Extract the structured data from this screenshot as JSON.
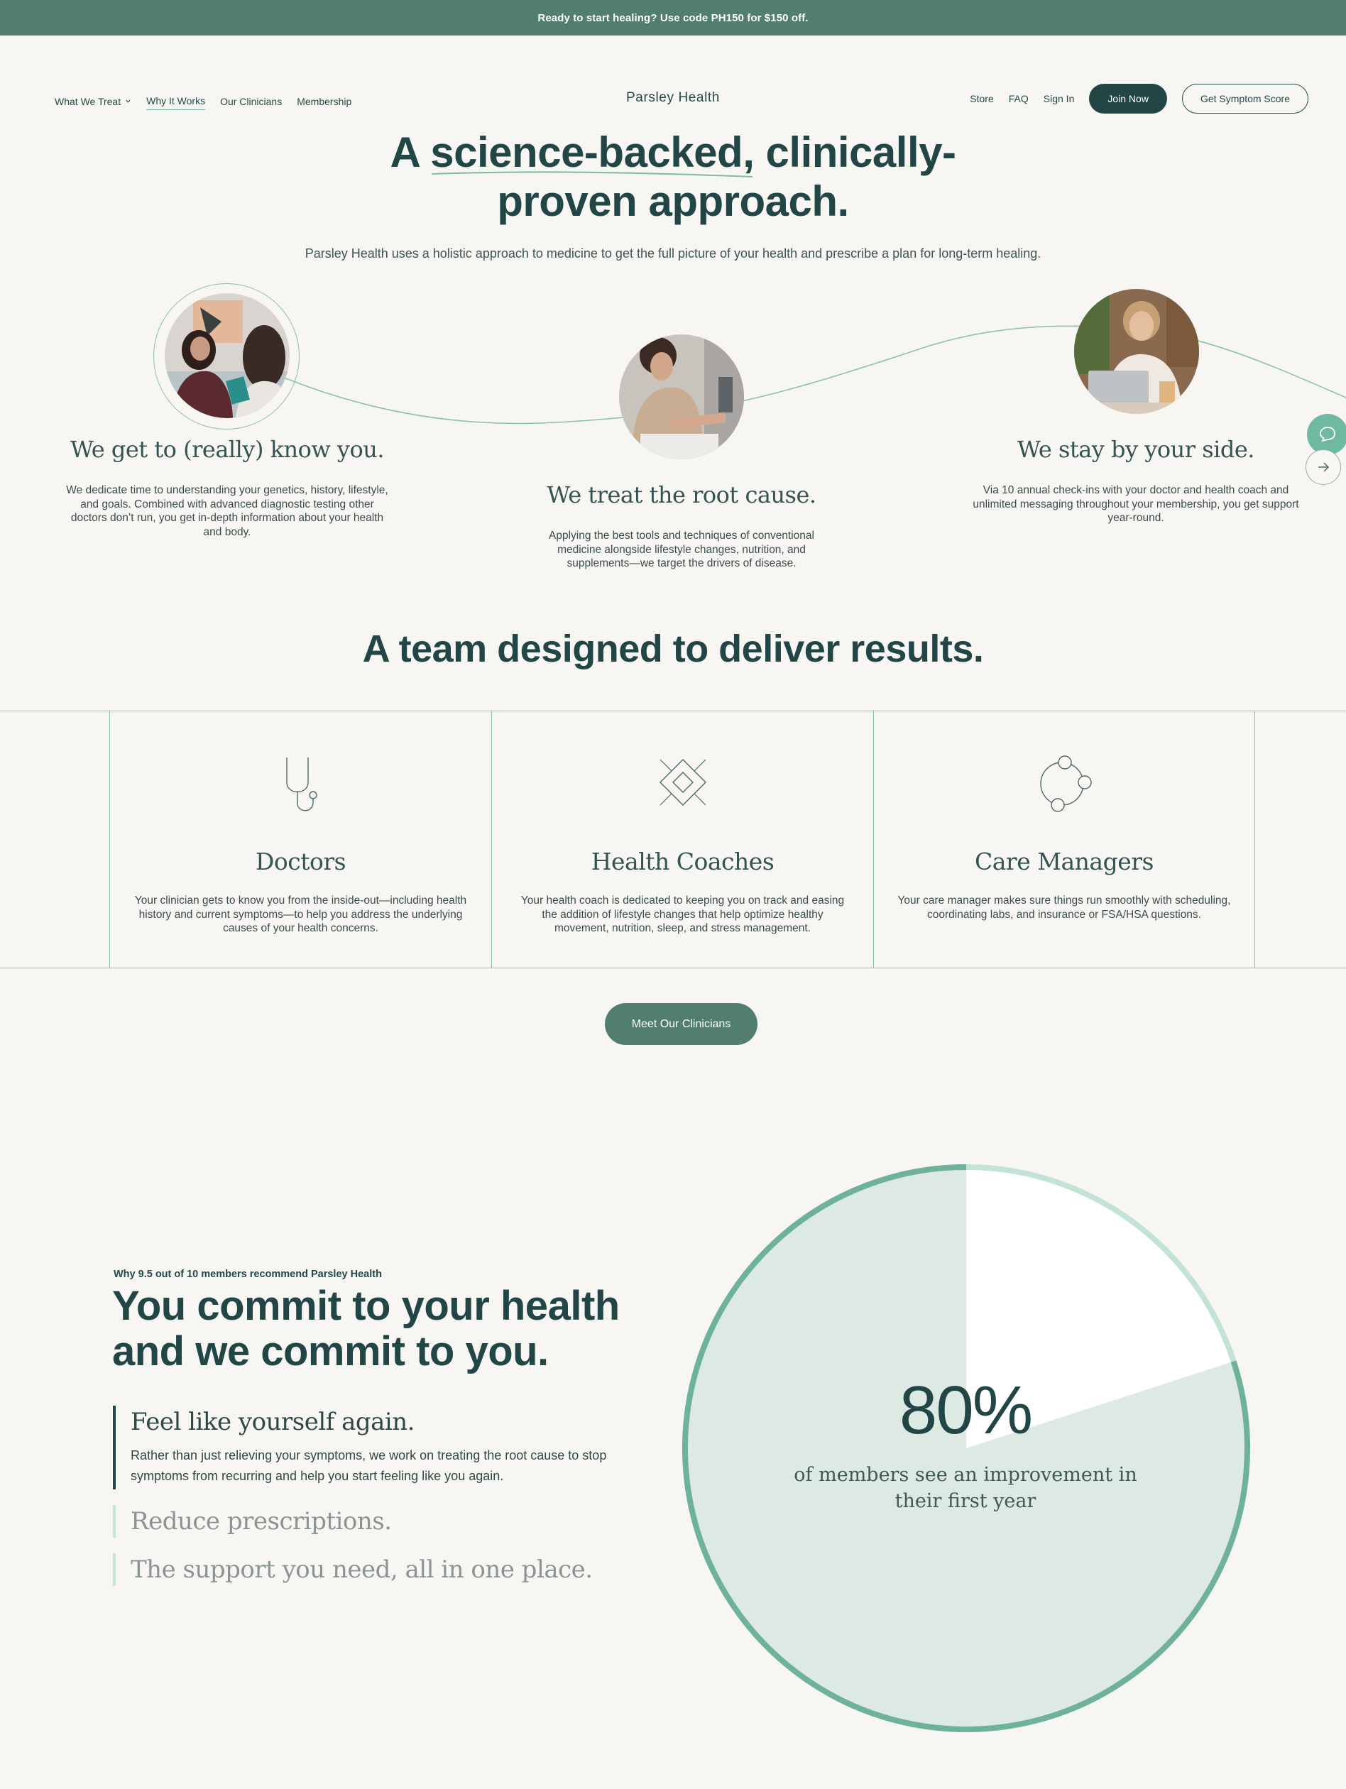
{
  "promo": {
    "text": "Ready to start healing? Use code PH150 for $150 off."
  },
  "nav": {
    "left": [
      {
        "label": "What We Treat",
        "icon": "chevron-down-icon"
      },
      {
        "label": "Why It Works"
      },
      {
        "label": "Our Clinicians"
      },
      {
        "label": "Membership"
      }
    ],
    "brand": "Parsley Health",
    "right": {
      "store": "Store",
      "faq": "FAQ",
      "sign_in": "Sign In",
      "join": "Join Now",
      "symptom_score": "Get Symptom Score"
    }
  },
  "hero": {
    "title_part1": "A ",
    "title_highlight": "science-backed,",
    "title_part2": " clinically-",
    "title_line2": "proven approach.",
    "subtitle": "Parsley Health uses a holistic approach to medicine to get the full picture of your health and prescribe a plan for long-term healing."
  },
  "steps": [
    {
      "title": "We get to (really) know you.",
      "body": "We dedicate time to understanding your genetics, history, lifestyle, and goals. Combined with advanced diagnostic testing other doctors don’t run, you get in-depth information about your health and body."
    },
    {
      "title": "We treat the root cause.",
      "body": "Applying the best tools and techniques of conventional medicine alongside lifestyle changes, nutrition, and supplements—we target the drivers of disease."
    },
    {
      "title": "We stay by your side.",
      "body": "Via 10 annual check-ins with your doctor and health coach and unlimited messaging throughout your membership, you get support year-round."
    }
  ],
  "team": {
    "title": "A team designed to deliver results.",
    "cards": [
      {
        "name": "Doctors",
        "icon": "stethoscope-icon",
        "desc": "Your clinician gets to know you from the inside-out—including health history and current symptoms—to help you address the underlying causes of your health concerns."
      },
      {
        "name": "Health Coaches",
        "icon": "diamond-icon",
        "desc": "Your health coach is dedicated to keeping you on track and easing the addition of lifestyle changes that help optimize healthy movement, nutrition, sleep, and stress management."
      },
      {
        "name": "Care Managers",
        "icon": "network-circles-icon",
        "desc": "Your care manager makes sure things run smoothly with scheduling, coordinating labs, and insurance or FSA/HSA questions."
      }
    ],
    "cta": "Meet Our Clinicians"
  },
  "commit": {
    "eyebrow": "Why 9.5 out of 10 members recommend Parsley Health",
    "title": "You commit to your health and we commit to you.",
    "items": [
      {
        "title": "Feel like yourself again.",
        "body": "Rather than just relieving your symptoms, we work on treating the root cause to stop symptoms from recurring and help you start feeling like you again.",
        "open": true
      },
      {
        "title": "Reduce prescriptions.",
        "open": false
      },
      {
        "title": "The support you need, all in one place.",
        "open": false
      }
    ],
    "stat": {
      "value": "80%",
      "fraction": 0.8,
      "label": "of members see an improvement in their first year"
    }
  },
  "colors": {
    "dark": "#224646",
    "accent": "#517e71",
    "mint": "#6fb8a2",
    "pie_fill": "#dde9e3",
    "background": "#f7f6f3"
  },
  "floating": {
    "chat_icon": "chat-bubble-icon",
    "next_icon": "arrow-right-icon"
  }
}
